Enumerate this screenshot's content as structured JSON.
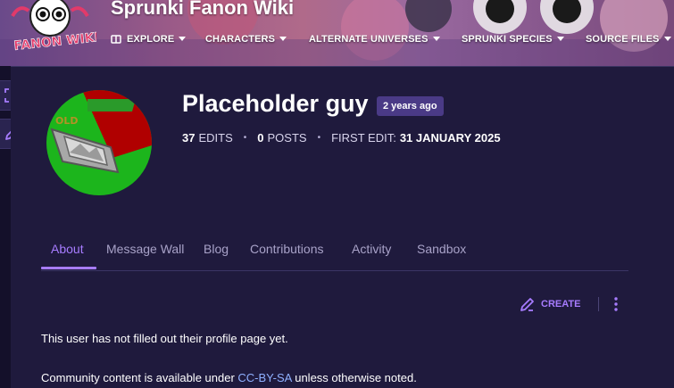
{
  "header": {
    "wiki_name": "Sprunki Fanon Wiki",
    "logo_text": "FANON WIKI",
    "nav": [
      {
        "label": "EXPLORE",
        "icon": "compass-icon"
      },
      {
        "label": "CHARACTERS",
        "icon": "chevron-down-icon"
      },
      {
        "label": "ALTERNATE UNIVERSES",
        "icon": "chevron-down-icon"
      },
      {
        "label": "SPRUNKI SPECIES",
        "icon": "chevron-down-icon"
      },
      {
        "label": "SOURCE FILES",
        "icon": "chevron-down-icon"
      }
    ]
  },
  "side_tools": [
    {
      "icon": "fullscreen-icon"
    },
    {
      "icon": "edit-pencil-icon"
    }
  ],
  "profile": {
    "name": "Placeholder guy",
    "badge": "2 years ago",
    "edits_count": "37",
    "edits_label": "EDITS",
    "posts_count": "0",
    "posts_label": "POSTS",
    "first_edit_label": "FIRST EDIT:",
    "first_edit_value": "31 JANUARY 2025",
    "avatar_colors": {
      "green": "#1cb51c",
      "red": "#b00000"
    }
  },
  "tabs": [
    {
      "label": "About",
      "active": true
    },
    {
      "label": "Message Wall",
      "active": false
    },
    {
      "label": "Blog",
      "active": false
    },
    {
      "label": "Contributions",
      "active": false
    },
    {
      "label": "Activity",
      "active": false
    },
    {
      "label": "Sandbox",
      "active": false
    }
  ],
  "actions": {
    "create_label": "CREATE",
    "create_icon": "pencil-icon",
    "more_icon": "kebab-menu-icon"
  },
  "main": {
    "empty_message": "This user has not filled out their profile page yet."
  },
  "footer": {
    "license_prefix": "Community content is available under ",
    "license_link": "CC-BY-SA",
    "license_suffix": " unless otherwise noted."
  },
  "colors": {
    "accent": "#a77cff",
    "background": "#1f1a3d",
    "link": "#8fb0ff"
  }
}
